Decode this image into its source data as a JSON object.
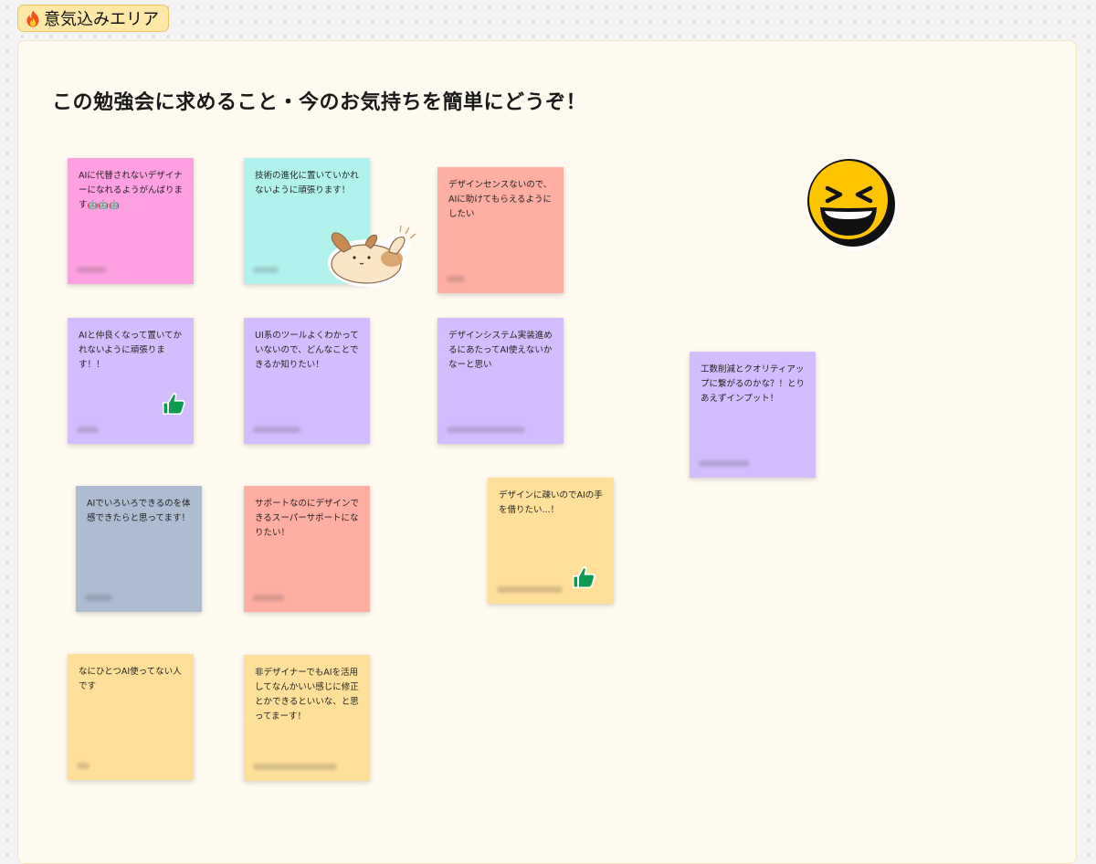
{
  "section": {
    "title": "意気込みエリア",
    "icon": "fire-icon",
    "accent_color": "#fde8a8"
  },
  "heading": "この勉強会に求めること・今のお気持ちを簡単にどうぞ！",
  "stickies": [
    {
      "text": "AIに代替されないデザイナーになれるようがんばります🤖🤖🤖",
      "color": "#ffa1e0"
    },
    {
      "text": "技術の進化に置いていかれないように頑張ります！",
      "color": "#b2f2ed"
    },
    {
      "text": "デザインセンスないので、AIに助けてもらえるようにしたい",
      "color": "#ffaea2"
    },
    {
      "text": "AIと仲良くなって置いてかれないように頑張ります！！",
      "color": "#d4bdfe"
    },
    {
      "text": "UI系のツールよくわかっていないので、どんなことできるか知りたい！",
      "color": "#d4bdfe"
    },
    {
      "text": "デザインシステム実装進めるにあたってAI使えないかなーと思い",
      "color": "#d4bdfe"
    },
    {
      "text": "工数削減とクオリティアップに繋がるのかな？！とりあえずインプット！",
      "color": "#d4bdfe"
    },
    {
      "text": "AIでいろいろできるのを体感できたらと思ってます！",
      "color": "#adbcd1"
    },
    {
      "text": "サポートなのにデザインできるスーパーサポートになりたい！",
      "color": "#ffaea2"
    },
    {
      "text": "デザインに疎いのでAIの手を借りたい...！",
      "color": "#ffe09a"
    },
    {
      "text": "なにひとつAI使ってない人です",
      "color": "#ffe09a"
    },
    {
      "text": "非デザイナーでもAIを活用してなんかいい感じに修正とかできるといいな、と思ってまーす！",
      "color": "#ffe09a"
    }
  ],
  "stickers": {
    "thumbs_up": "thumbs-up-icon",
    "dog": "waving-dog-sticker",
    "smiley": "laughing-face-icon"
  }
}
